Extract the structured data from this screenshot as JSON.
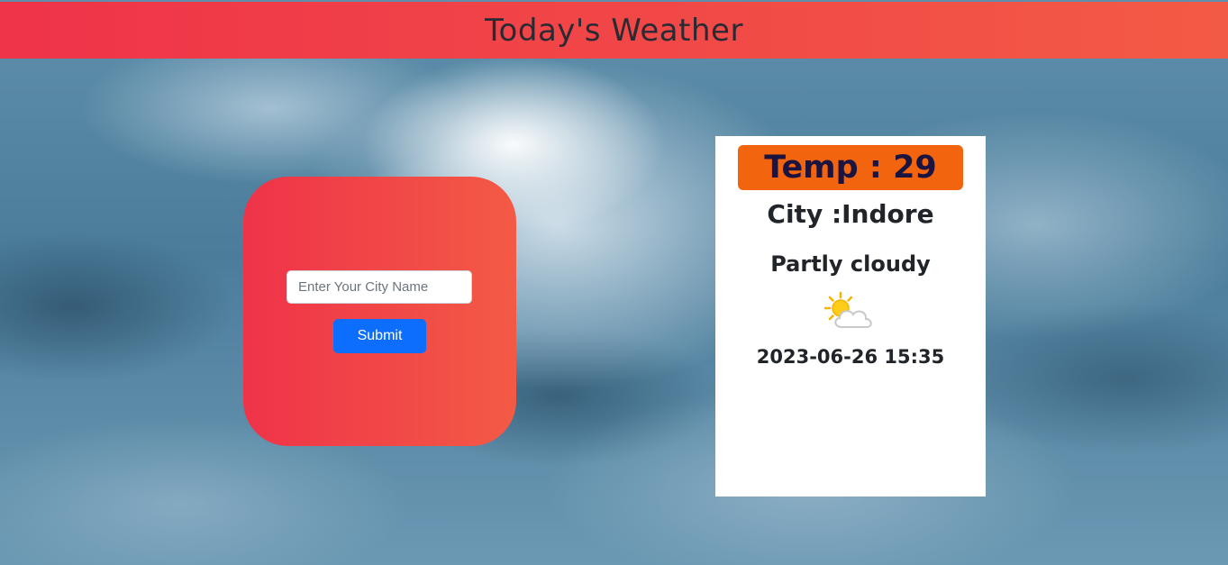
{
  "header": {
    "title": "Today's Weather"
  },
  "search": {
    "placeholder": "Enter Your City Name",
    "value": "",
    "submit_label": "Submit"
  },
  "weather": {
    "temp_label": "Temp : 29",
    "city_label": "City :Indore",
    "condition": "Partly cloudy",
    "icon": "partly-cloudy-icon",
    "datetime": "2023-06-26 15:35"
  },
  "colors": {
    "header_gradient_start": "#ef3349",
    "header_gradient_end": "#f35a45",
    "temp_badge": "#f2640d",
    "submit_button": "#0d6efd"
  }
}
